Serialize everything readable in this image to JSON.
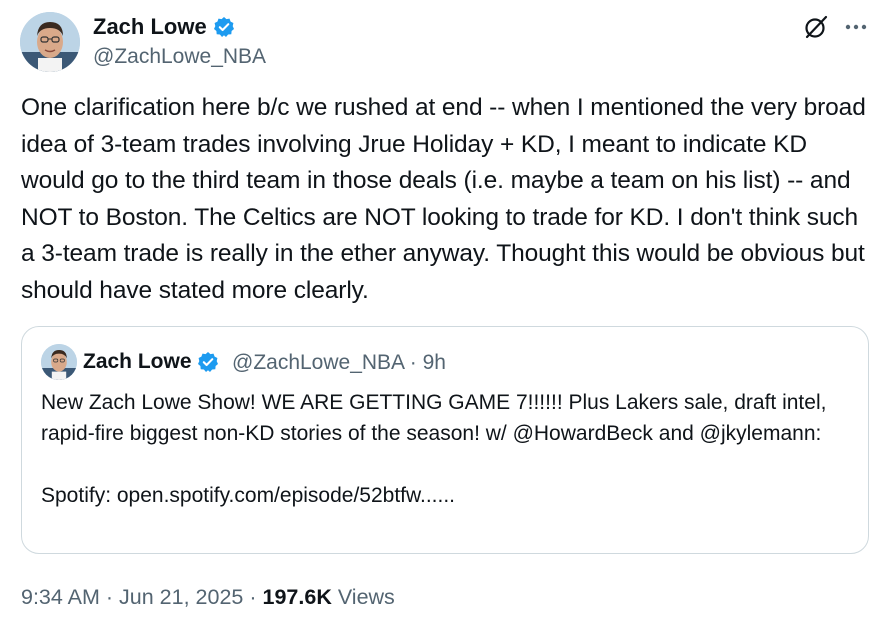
{
  "author": {
    "name": "Zach Lowe",
    "handle": "@ZachLowe_NBA",
    "verified_color": "#1d9bf0"
  },
  "header_icons": [
    "grok-icon",
    "more-icon"
  ],
  "tweet": {
    "text": "One clarification here b/c we rushed at end -- when I mentioned the very broad idea of 3-team trades involving Jrue Holiday + KD, I meant to indicate KD would go to the third team in those deals (i.e. maybe a team on his list) -- and NOT to Boston. The Celtics are NOT looking to trade for KD. I don't think such a 3-team trade is really in the ether anyway. Thought this would be obvious but should have stated more clearly."
  },
  "quote": {
    "name": "Zach Lowe",
    "handle": "@ZachLowe_NBA",
    "separator": "·",
    "age": "9h",
    "text_line1": "New Zach Lowe Show! WE ARE GETTING GAME 7!!!!!! Plus Lakers sale, draft intel, rapid-fire biggest non-KD stories of the season! w/ @HowardBeck and @jkylemann:",
    "text_line2": "Spotify: open.spotify.com/episode/52btfw......"
  },
  "footer": {
    "time": "9:34 AM",
    "sep1": "·",
    "date": "Jun 21, 2025",
    "sep2": "·",
    "views_count": "197.6K",
    "views_label": "Views"
  }
}
